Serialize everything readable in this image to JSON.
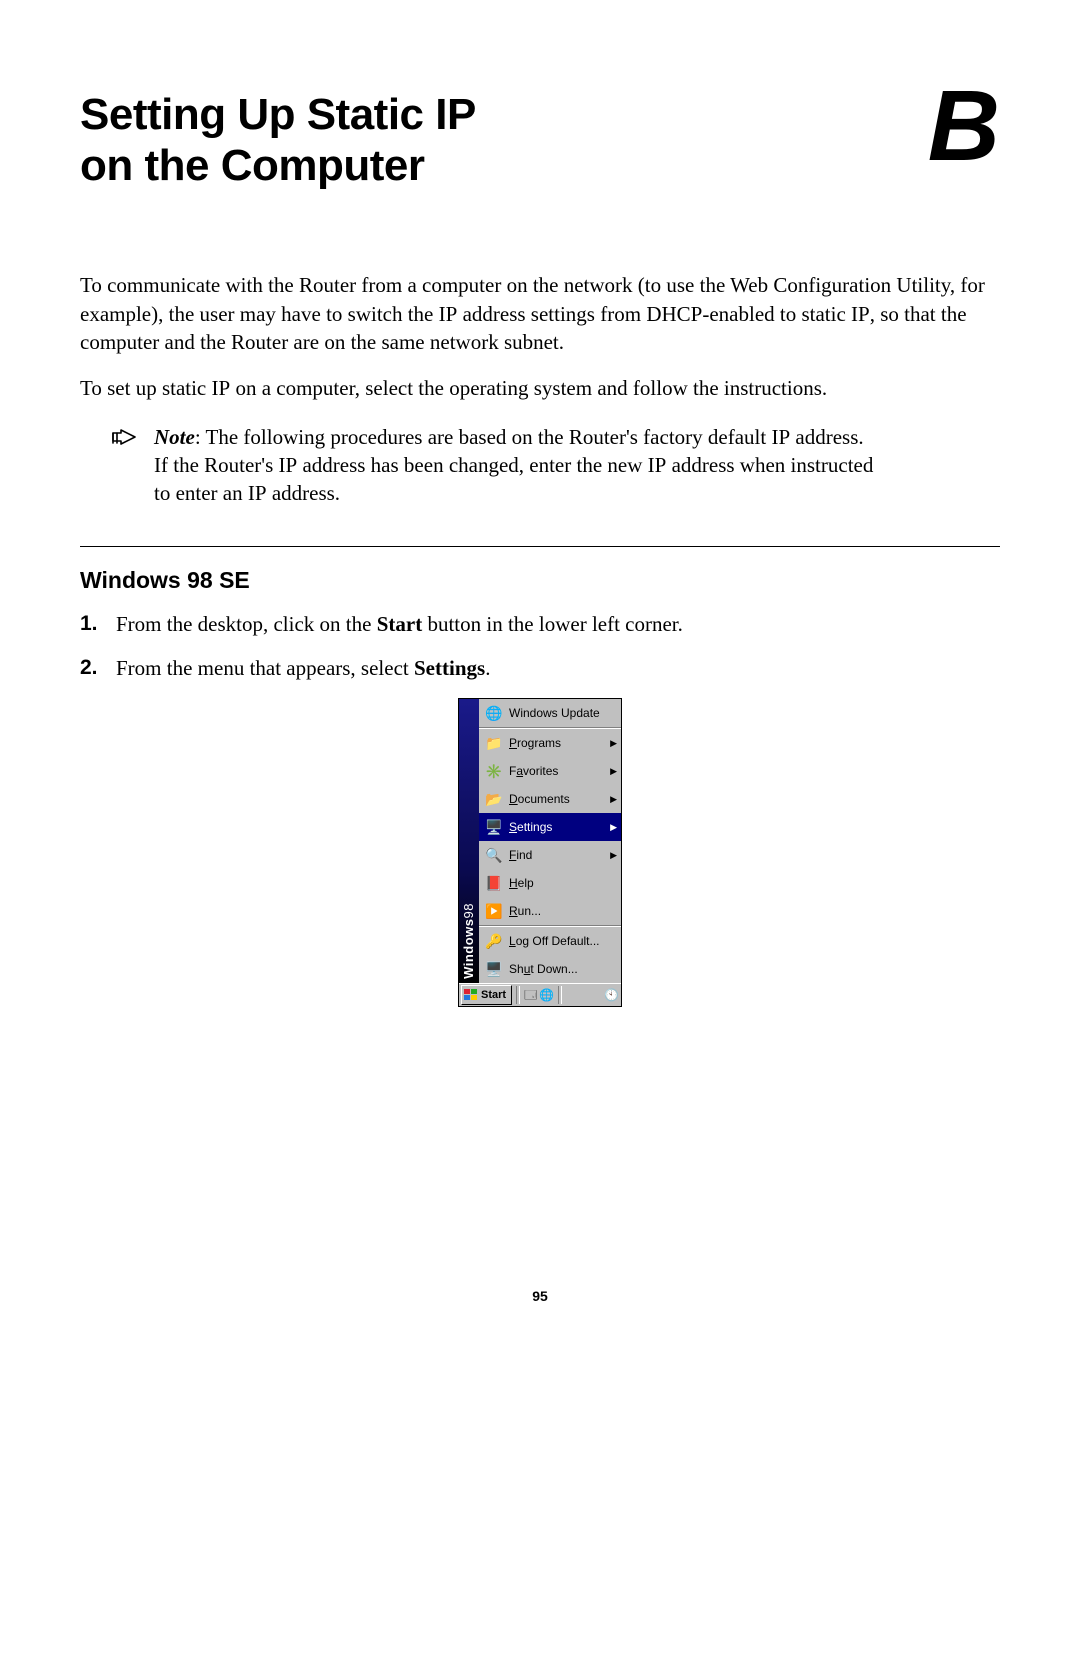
{
  "header": {
    "title_line1": "Setting Up Static IP",
    "title_line2": "on the Computer",
    "appendix_letter": "B"
  },
  "intro_paragraph_html": "To communicate with the Router from a computer on the network (to use the Web Configuration Utility, for example), the user may have to switch the <span class=\"sc\">IP</span> address settings from <span class=\"sc\">DHCP</span>-enabled to static <span class=\"sc\">IP</span>, so that the computer and the Router are on the same network subnet.",
  "second_paragraph_html": "To set up static <span class=\"sc\">IP</span> on a computer, select the operating system and follow the instructions.",
  "note": {
    "label": "Note",
    "text_html": ": The following procedures are based on the Router's factory default <span class=\"sc\">IP</span> address. If the Router's <span class=\"sc\">IP</span> address has been changed, enter the new <span class=\"sc\">IP</span> address when instructed to enter an <span class=\"sc\">IP</span> address."
  },
  "section_heading": "Windows 98 SE",
  "steps": [
    "From the desktop, click on the <strong>Start</strong> button in the lower left corner.",
    "From the menu that appears, select <strong>Settings</strong>."
  ],
  "start_menu": {
    "side_label_html": "<span>Windows</span><span class=\"w98\">98</span>",
    "items": [
      {
        "icon": "🌐",
        "label_html": "Windows Update",
        "arrow": false,
        "selected": false,
        "sep_after": true
      },
      {
        "icon": "📁",
        "label_html": "<span class=\"u\">P</span>rograms",
        "arrow": true,
        "selected": false,
        "sep_after": false
      },
      {
        "icon": "✳️",
        "label_html": "F<span class=\"u\">a</span>vorites",
        "arrow": true,
        "selected": false,
        "sep_after": false
      },
      {
        "icon": "📂",
        "label_html": "<span class=\"u\">D</span>ocuments",
        "arrow": true,
        "selected": false,
        "sep_after": false
      },
      {
        "icon": "🖥️",
        "label_html": "<span class=\"u\">S</span>ettings",
        "arrow": true,
        "selected": true,
        "sep_after": false
      },
      {
        "icon": "🔍",
        "label_html": "<span class=\"u\">F</span>ind",
        "arrow": true,
        "selected": false,
        "sep_after": false
      },
      {
        "icon": "📕",
        "label_html": "<span class=\"u\">H</span>elp",
        "arrow": false,
        "selected": false,
        "sep_after": false
      },
      {
        "icon": "▶️",
        "label_html": "<span class=\"u\">R</span>un...",
        "arrow": false,
        "selected": false,
        "sep_after": true
      },
      {
        "icon": "🔑",
        "label_html": "<span class=\"u\">L</span>og Off Default...",
        "arrow": false,
        "selected": false,
        "sep_after": false
      },
      {
        "icon": "🖥️",
        "label_html": "Sh<span class=\"u\">u</span>t Down...",
        "arrow": false,
        "selected": false,
        "sep_after": false
      }
    ],
    "taskbar": {
      "start_label": "Start",
      "quicklaunch": [
        "🗔",
        "🌐"
      ],
      "tray": "🕙"
    }
  },
  "page_number": "95"
}
